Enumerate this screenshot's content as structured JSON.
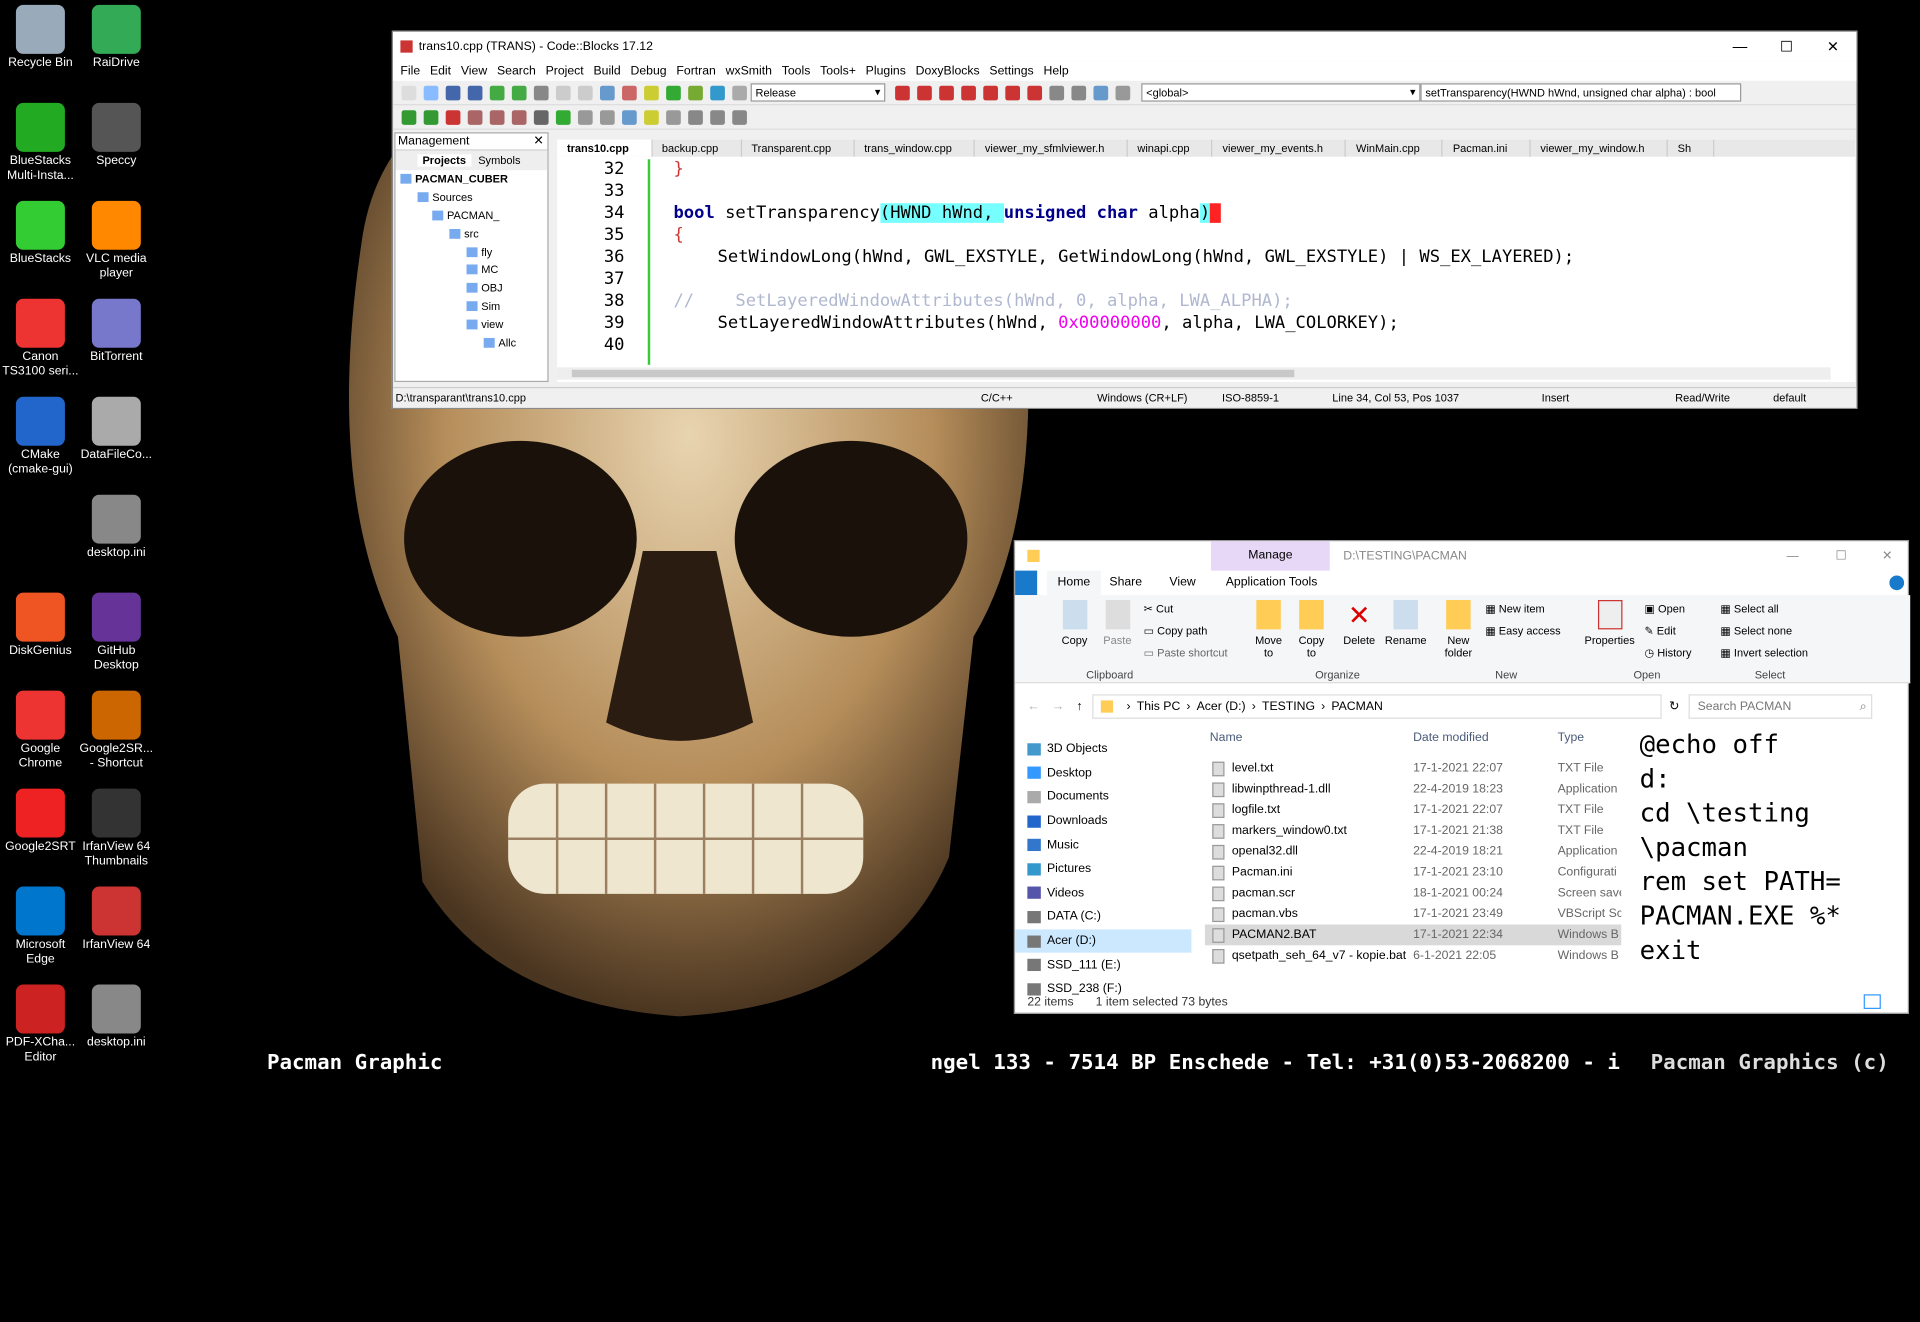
{
  "desktop": {
    "icons": [
      "Recycle Bin",
      "RaiDrive",
      "BlueStacks Multi-Insta...",
      "Speccy",
      "BlueStacks",
      "VLC media player",
      "Canon TS3100 seri...",
      "BitTorrent",
      "CMake (cmake-gui)",
      "DataFileCo...",
      "desktop.ini",
      "DiskGenius",
      "GitHub Desktop",
      "Google Chrome",
      "Google2SR... - Shortcut",
      "Google2SRT",
      "IrfanView 64 Thumbnails",
      "Microsoft Edge",
      "IrfanView 64",
      "PDF-XCha... Editor",
      "desktop.ini"
    ],
    "ticker_left": "Pacman Graphic",
    "ticker_mid": "ngel 133 - 7514 BP Enschede - Tel: +31(0)53-2068200 - i",
    "ticker_right": "Pacman Graphics (c)"
  },
  "codeblocks": {
    "title": "trans10.cpp (TRANS) - Code::Blocks 17.12",
    "menu": [
      "File",
      "Edit",
      "View",
      "Search",
      "Project",
      "Build",
      "Debug",
      "Fortran",
      "wxSmith",
      "Tools",
      "Tools+",
      "Plugins",
      "DoxyBlocks",
      "Settings",
      "Help"
    ],
    "build_target": "Release",
    "scope": "<global>",
    "function": "setTransparency(HWND hWnd, unsigned char alpha) : bool",
    "management": {
      "title": "Management",
      "tabs": [
        "Projects",
        "Symbols"
      ],
      "tree": [
        "PACMAN_CUBER",
        "Sources",
        "PACMAN_",
        "src",
        "fly",
        "MC",
        "OBJ",
        "Sim",
        "view",
        "Allc"
      ]
    },
    "tabs": [
      "trans10.cpp",
      "backup.cpp",
      "Transparent.cpp",
      "trans_window.cpp",
      "viewer_my_sfmlviewer.h",
      "winapi.cpp",
      "viewer_my_events.h",
      "WinMain.cpp",
      "Pacman.ini",
      "viewer_my_window.h",
      "Sh"
    ],
    "lines": {
      "n32": "32",
      "n33": "33",
      "n34": "34",
      "n35": "35",
      "n36": "36",
      "n37": "37",
      "n38": "38",
      "n39": "39",
      "n40": "40"
    },
    "code": {
      "l32": "}",
      "l34_kw1": "bool",
      "l34_a": " setTransparency",
      "l34_b": "(HWND hWnd, ",
      "l34_kw2": "unsigned char",
      "l34_c": " alpha",
      "l34_d": ")",
      "l35": "{",
      "l36": "SetWindowLong(hWnd, GWL_EXSTYLE, GetWindowLong(hWnd, GWL_EXSTYLE) | WS_EX_LAYERED);",
      "l38": "//    SetLayeredWindowAttributes(hWnd, 0, alpha, LWA_ALPHA);",
      "l39_a": "SetLayeredWindowAttributes(hWnd, ",
      "l39_num": "0x00000000",
      "l39_b": ", alpha, LWA_COLORKEY);"
    },
    "status": {
      "path": "D:\\transparant\\trans10.cpp",
      "lang": "C/C++",
      "eol": "Windows (CR+LF)",
      "enc": "ISO-8859-1",
      "pos": "Line 34, Col 53, Pos 1037",
      "mode": "Insert",
      "rw": "Read/Write",
      "profile": "default"
    }
  },
  "explorer": {
    "path_title": "D:\\TESTING\\PACMAN",
    "manage": "Manage",
    "tabs": [
      "Home",
      "Share",
      "View",
      "Application Tools"
    ],
    "clip": {
      "copy": "Copy",
      "paste": "Paste",
      "cut": "Cut",
      "copy_path": "Copy path",
      "paste_shortcut": "Paste shortcut",
      "group": "Clipboard"
    },
    "org": {
      "move": "Move to",
      "copy": "Copy to",
      "delete": "Delete",
      "rename": "Rename",
      "group": "Organize"
    },
    "new": {
      "folder": "New folder",
      "item": "New item",
      "easy": "Easy access",
      "group": "New"
    },
    "open": {
      "props": "Properties",
      "open": "Open",
      "edit": "Edit",
      "history": "History",
      "group": "Open"
    },
    "select": {
      "all": "Select all",
      "none": "Select none",
      "invert": "Invert selection",
      "group": "Select"
    },
    "crumbs": [
      "This PC",
      "Acer (D:)",
      "TESTING",
      "PACMAN"
    ],
    "search_placeholder": "Search PACMAN",
    "nav": [
      "3D Objects",
      "Desktop",
      "Documents",
      "Downloads",
      "Music",
      "Pictures",
      "Videos",
      "DATA (C:)",
      "Acer (D:)",
      "SSD_111 (E:)",
      "SSD_238 (F:)"
    ],
    "cols": {
      "name": "Name",
      "date": "Date modified",
      "type": "Type"
    },
    "files": [
      {
        "name": "level.txt",
        "date": "17-1-2021 22:07",
        "type": "TXT File"
      },
      {
        "name": "libwinpthread-1.dll",
        "date": "22-4-2019 18:23",
        "type": "Application"
      },
      {
        "name": "logfile.txt",
        "date": "17-1-2021 22:07",
        "type": "TXT File"
      },
      {
        "name": "markers_window0.txt",
        "date": "17-1-2021 21:38",
        "type": "TXT File"
      },
      {
        "name": "openal32.dll",
        "date": "22-4-2019 18:21",
        "type": "Application"
      },
      {
        "name": "Pacman.ini",
        "date": "17-1-2021 23:10",
        "type": "Configurati"
      },
      {
        "name": "pacman.scr",
        "date": "18-1-2021 00:24",
        "type": "Screen save"
      },
      {
        "name": "pacman.vbs",
        "date": "17-1-2021 23:49",
        "type": "VBScript Sc"
      },
      {
        "name": "PACMAN2.BAT",
        "date": "17-1-2021 22:34",
        "type": "Windows B"
      },
      {
        "name": "qsetpath_seh_64_v7 - kopie.bat",
        "date": "6-1-2021 22:05",
        "type": "Windows B"
      }
    ],
    "preview": [
      "@echo off",
      "d:",
      "cd \\testing",
      "\\pacman",
      "rem set PATH=",
      "PACMAN.EXE %*",
      "exit"
    ],
    "status_items": "22 items",
    "status_sel": "1 item selected  73 bytes"
  }
}
